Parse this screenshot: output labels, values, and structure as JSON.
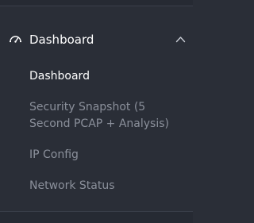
{
  "sidebar": {
    "section": {
      "label": "Dashboard",
      "icon": "dashboard-gauge-icon",
      "expanded": true
    },
    "items": [
      {
        "label": "Dashboard",
        "active": true
      },
      {
        "label": "Security Snapshot (5 Second PCAP + Analysis)",
        "active": false
      },
      {
        "label": "IP Config",
        "active": false
      },
      {
        "label": "Network Status",
        "active": false
      }
    ]
  },
  "colors": {
    "background": "#2a2e37",
    "active_text": "#ffffff",
    "inactive_text": "#8b909b"
  }
}
